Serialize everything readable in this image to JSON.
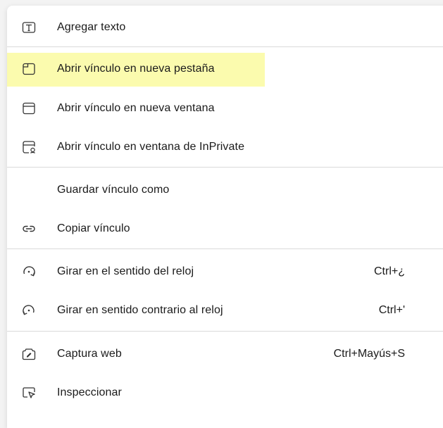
{
  "menu": {
    "items": [
      {
        "name": "agregar-texto",
        "label": "Agregar texto",
        "shortcut": "",
        "icon": "text-box-icon"
      },
      {
        "name": "abrir-nueva-pestana",
        "label": "Abrir vínculo en nueva pestaña",
        "shortcut": "",
        "icon": "new-tab-icon",
        "highlighted": true
      },
      {
        "name": "abrir-nueva-ventana",
        "label": "Abrir vínculo en nueva ventana",
        "shortcut": "",
        "icon": "new-window-icon"
      },
      {
        "name": "abrir-inprivate",
        "label": "Abrir vínculo en ventana de InPrivate",
        "shortcut": "",
        "icon": "inprivate-icon"
      },
      {
        "name": "guardar-vinculo",
        "label": "Guardar vínculo como",
        "shortcut": "",
        "icon": ""
      },
      {
        "name": "copiar-vinculo",
        "label": "Copiar vínculo",
        "shortcut": "",
        "icon": "link-icon"
      },
      {
        "name": "girar-reloj",
        "label": "Girar en el sentido del reloj",
        "shortcut": "Ctrl+¿",
        "icon": "rotate-clockwise-icon"
      },
      {
        "name": "girar-contrario",
        "label": "Girar en sentido contrario al reloj",
        "shortcut": "Ctrl+'",
        "icon": "rotate-counterclockwise-icon"
      },
      {
        "name": "captura-web",
        "label": "Captura web",
        "shortcut": "Ctrl+Mayús+S",
        "icon": "web-capture-icon"
      },
      {
        "name": "inspeccionar",
        "label": "Inspeccionar",
        "shortcut": "",
        "icon": "inspect-icon"
      }
    ]
  },
  "colors": {
    "highlight": "#fbfbae",
    "separator": "#d9d9d9",
    "text": "#1a1a1a"
  }
}
